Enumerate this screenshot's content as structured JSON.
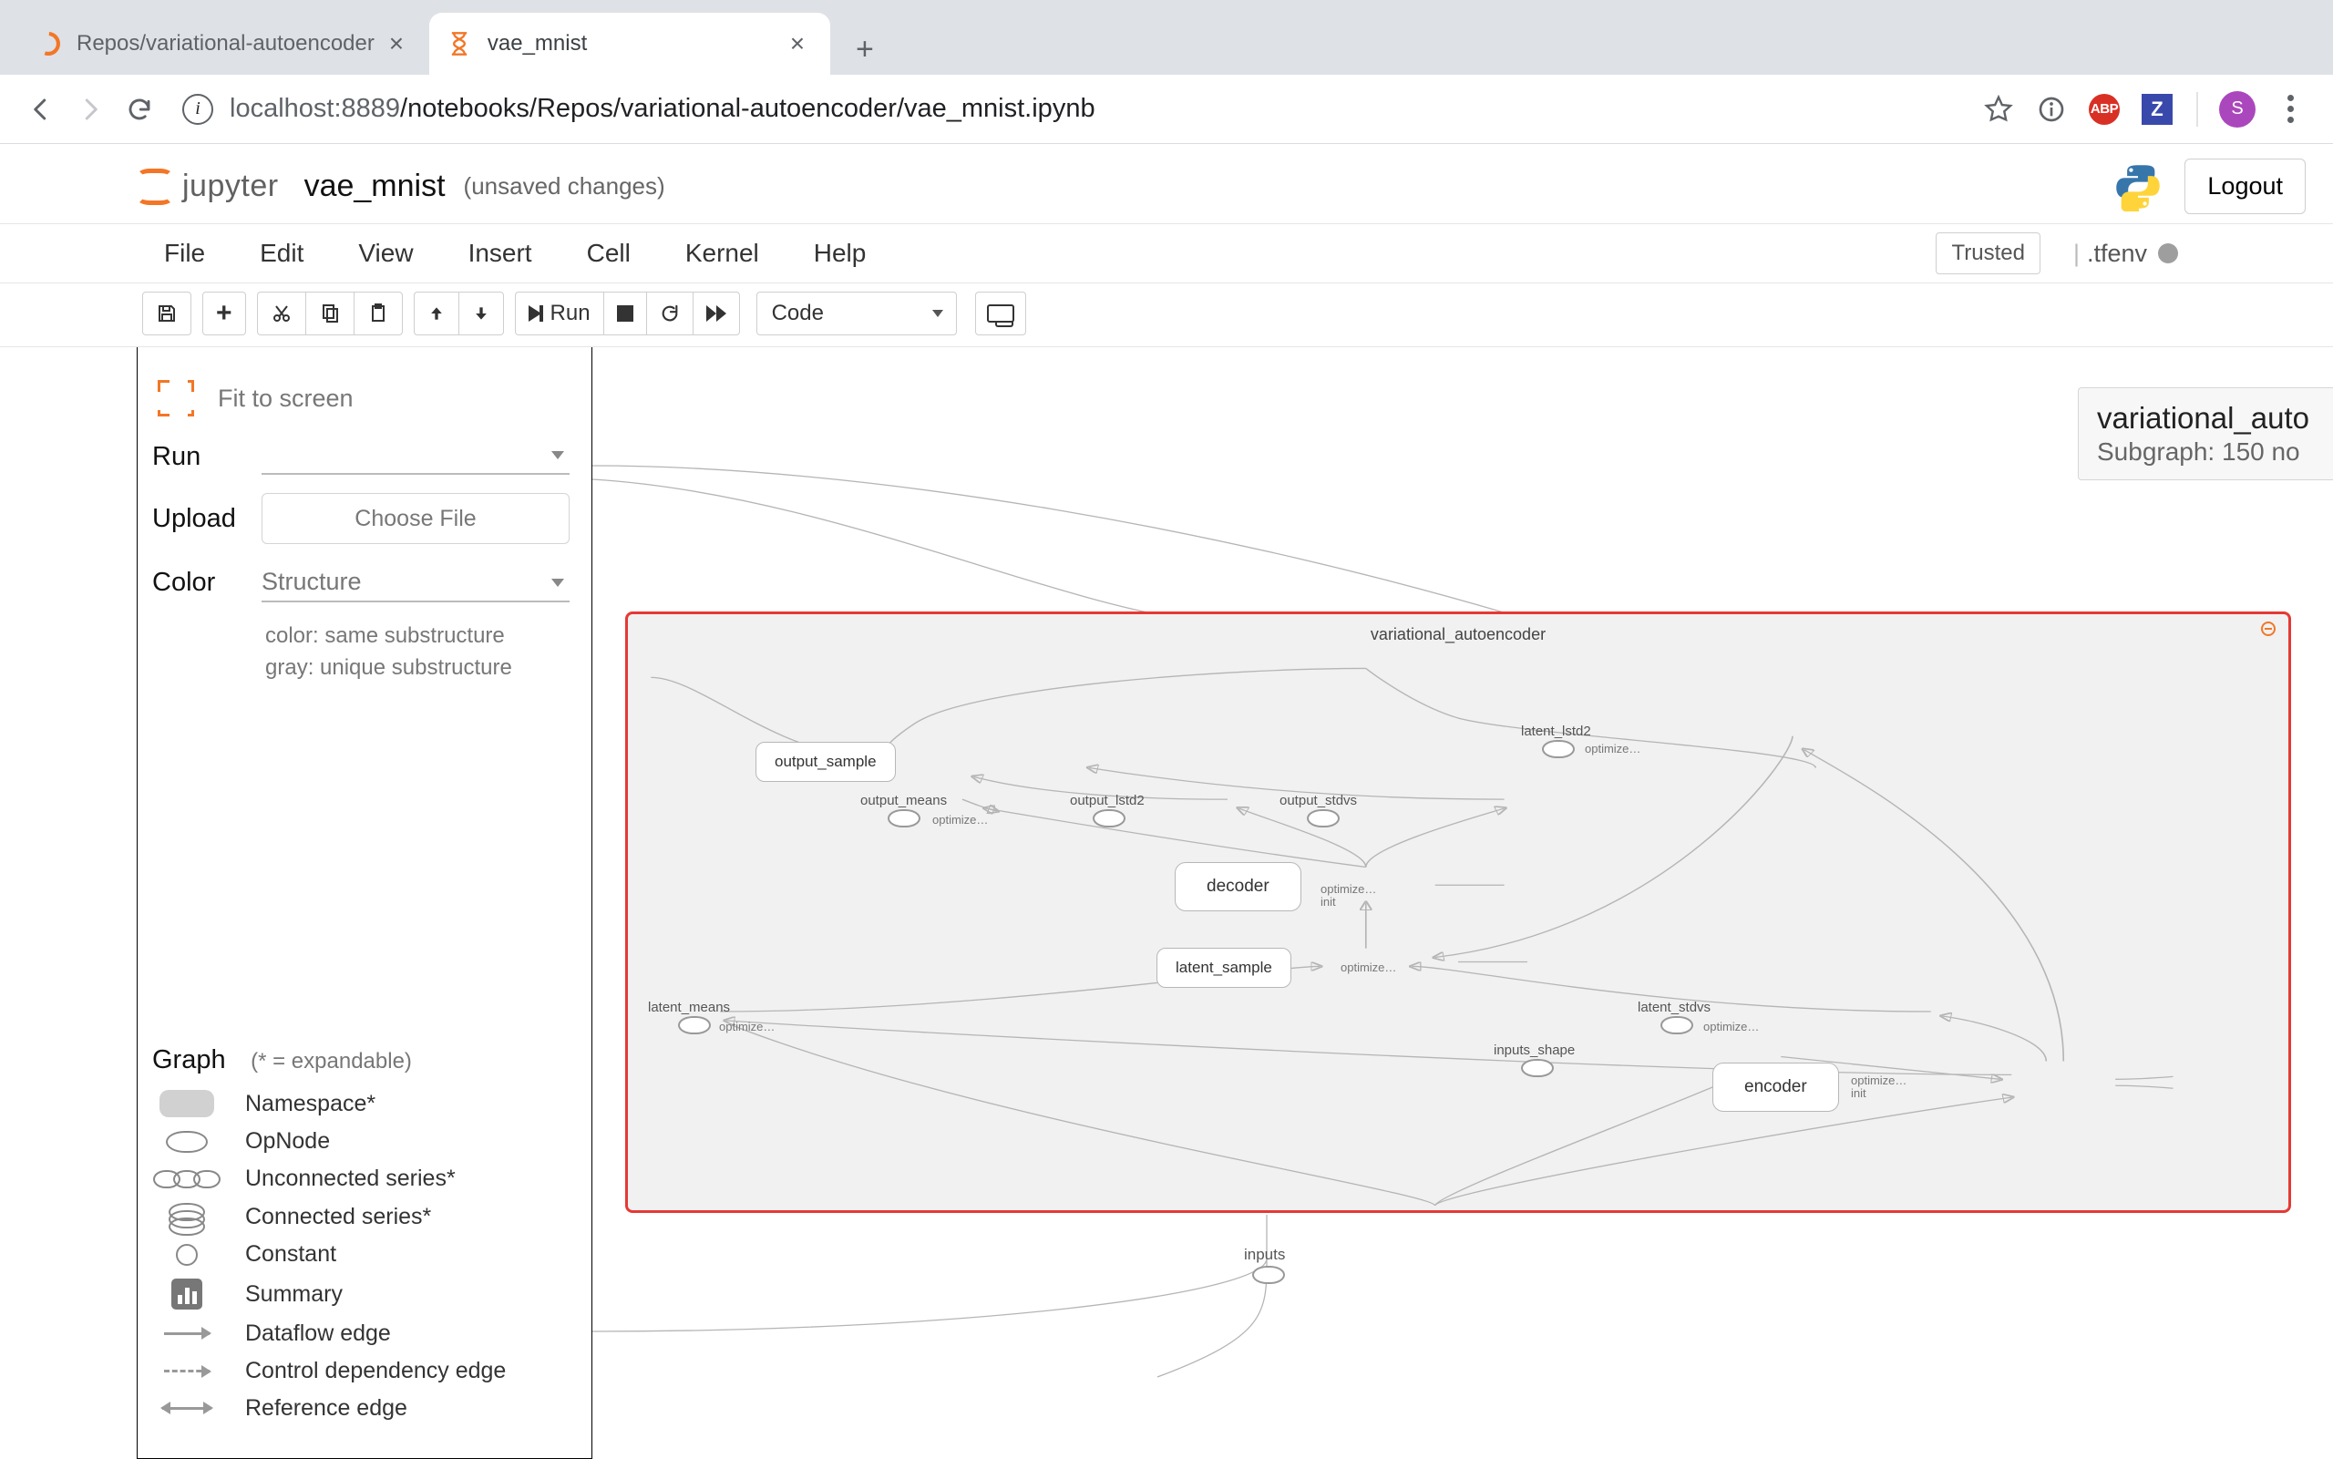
{
  "browser": {
    "tabs": [
      {
        "title": "Repos/variational-autoencoder",
        "active": false
      },
      {
        "title": "vae_mnist",
        "active": true
      }
    ],
    "url_host": "localhost",
    "url_port": ":8889",
    "url_path": "/notebooks/Repos/variational-autoencoder/vae_mnist.ipynb",
    "icons": {
      "abp": "ABP",
      "z": "Z",
      "avatar": "S"
    }
  },
  "jupyter": {
    "brand": "jupyter",
    "notebook_name": "vae_mnist",
    "save_status": "(unsaved changes)",
    "logout": "Logout",
    "menus": [
      "File",
      "Edit",
      "View",
      "Insert",
      "Cell",
      "Kernel",
      "Help"
    ],
    "trusted": "Trusted",
    "kernel": ".tfenv",
    "toolbar": {
      "run": "Run",
      "celltype": "Code"
    }
  },
  "tb_sidebar": {
    "fit": "Fit to screen",
    "labels": {
      "run": "Run",
      "upload": "Upload",
      "color": "Color"
    },
    "choose_file": "Choose File",
    "color_value": "Structure",
    "color_desc1": "color: same substructure",
    "color_desc2": "gray: unique substructure",
    "legend_title": "Graph",
    "legend_note": "(* = expandable)",
    "legend": [
      "Namespace*",
      "OpNode",
      "Unconnected series*",
      "Connected series*",
      "Constant",
      "Summary",
      "Dataflow edge",
      "Control dependency edge",
      "Reference edge"
    ]
  },
  "graph": {
    "scope_name": "variational_autoencoder",
    "tooltip_title": "variational_auto",
    "tooltip_sub": "Subgraph: 150 no",
    "nodes": {
      "output_sample": "output_sample",
      "output_means": "output_means",
      "output_lstd2": "output_lstd2",
      "output_stdvs": "output_stdvs",
      "decoder": "decoder",
      "latent_sample": "latent_sample",
      "latent_means": "latent_means",
      "latent_stdvs": "latent_stdvs",
      "latent_lstd2": "latent_lstd2",
      "inputs_shape": "inputs_shape",
      "encoder": "encoder",
      "inputs": "inputs",
      "optimize": "optimize…",
      "init": "init"
    }
  }
}
